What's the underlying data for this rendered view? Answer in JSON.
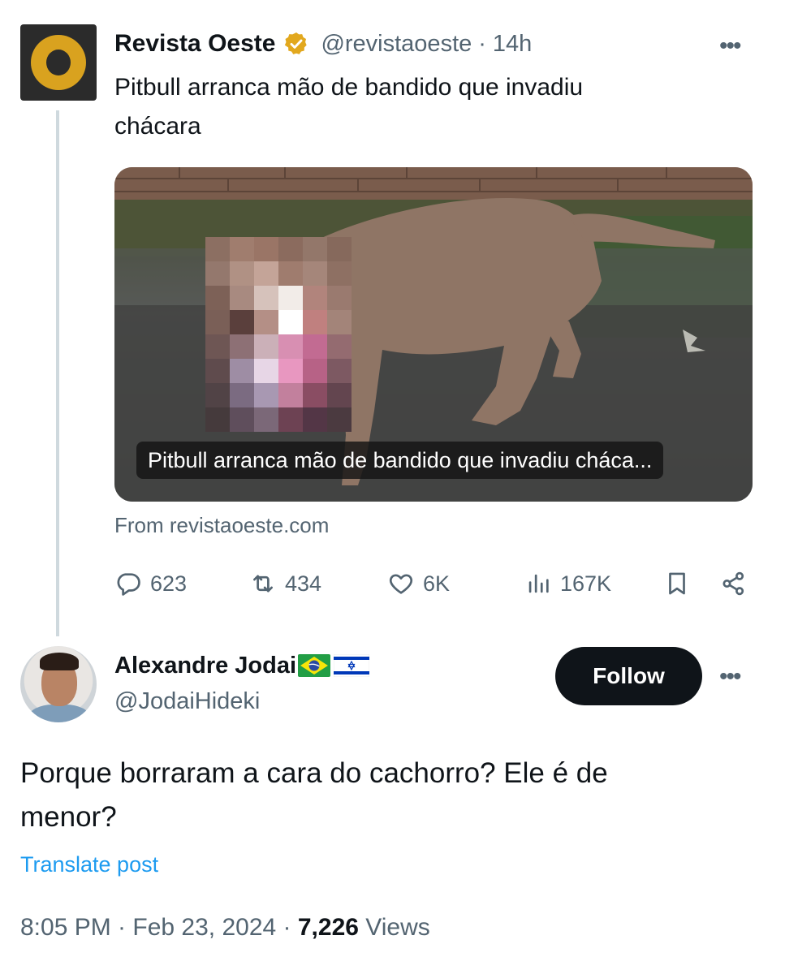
{
  "parent": {
    "author_name": "Revista Oeste",
    "handle": "@revistaoeste",
    "separator": "·",
    "time": "14h",
    "text_line1": "Pitbull arranca mão de bandido que invadiu",
    "text_line2": "chácara",
    "media_caption": "Pitbull arranca mão de bandido que invadiu cháca...",
    "source": "From revistaoeste.com",
    "more_icon": "more-horizontal-icon",
    "badge_color": "#e2a81e",
    "stats": {
      "replies": "623",
      "reposts": "434",
      "likes": "6K",
      "views": "167K"
    }
  },
  "reply": {
    "author_name": "Alexandre Jodai",
    "flags": [
      "brazil-flag-icon",
      "israel-flag-icon"
    ],
    "handle": "@JodaiHideki",
    "follow_label": "Follow",
    "text_line1": "Porque borraram a cara do cachorro? Ele é de",
    "text_line2": "menor?",
    "translate_label": "Translate post",
    "timestamp": "8:05 PM · Feb 23, 2024 ·",
    "views_count": "7,226",
    "views_label": "Views"
  },
  "colors": {
    "text_primary": "#0f1419",
    "text_secondary": "#536471",
    "link": "#1d9bf0",
    "follow_bg": "#0f1419"
  }
}
